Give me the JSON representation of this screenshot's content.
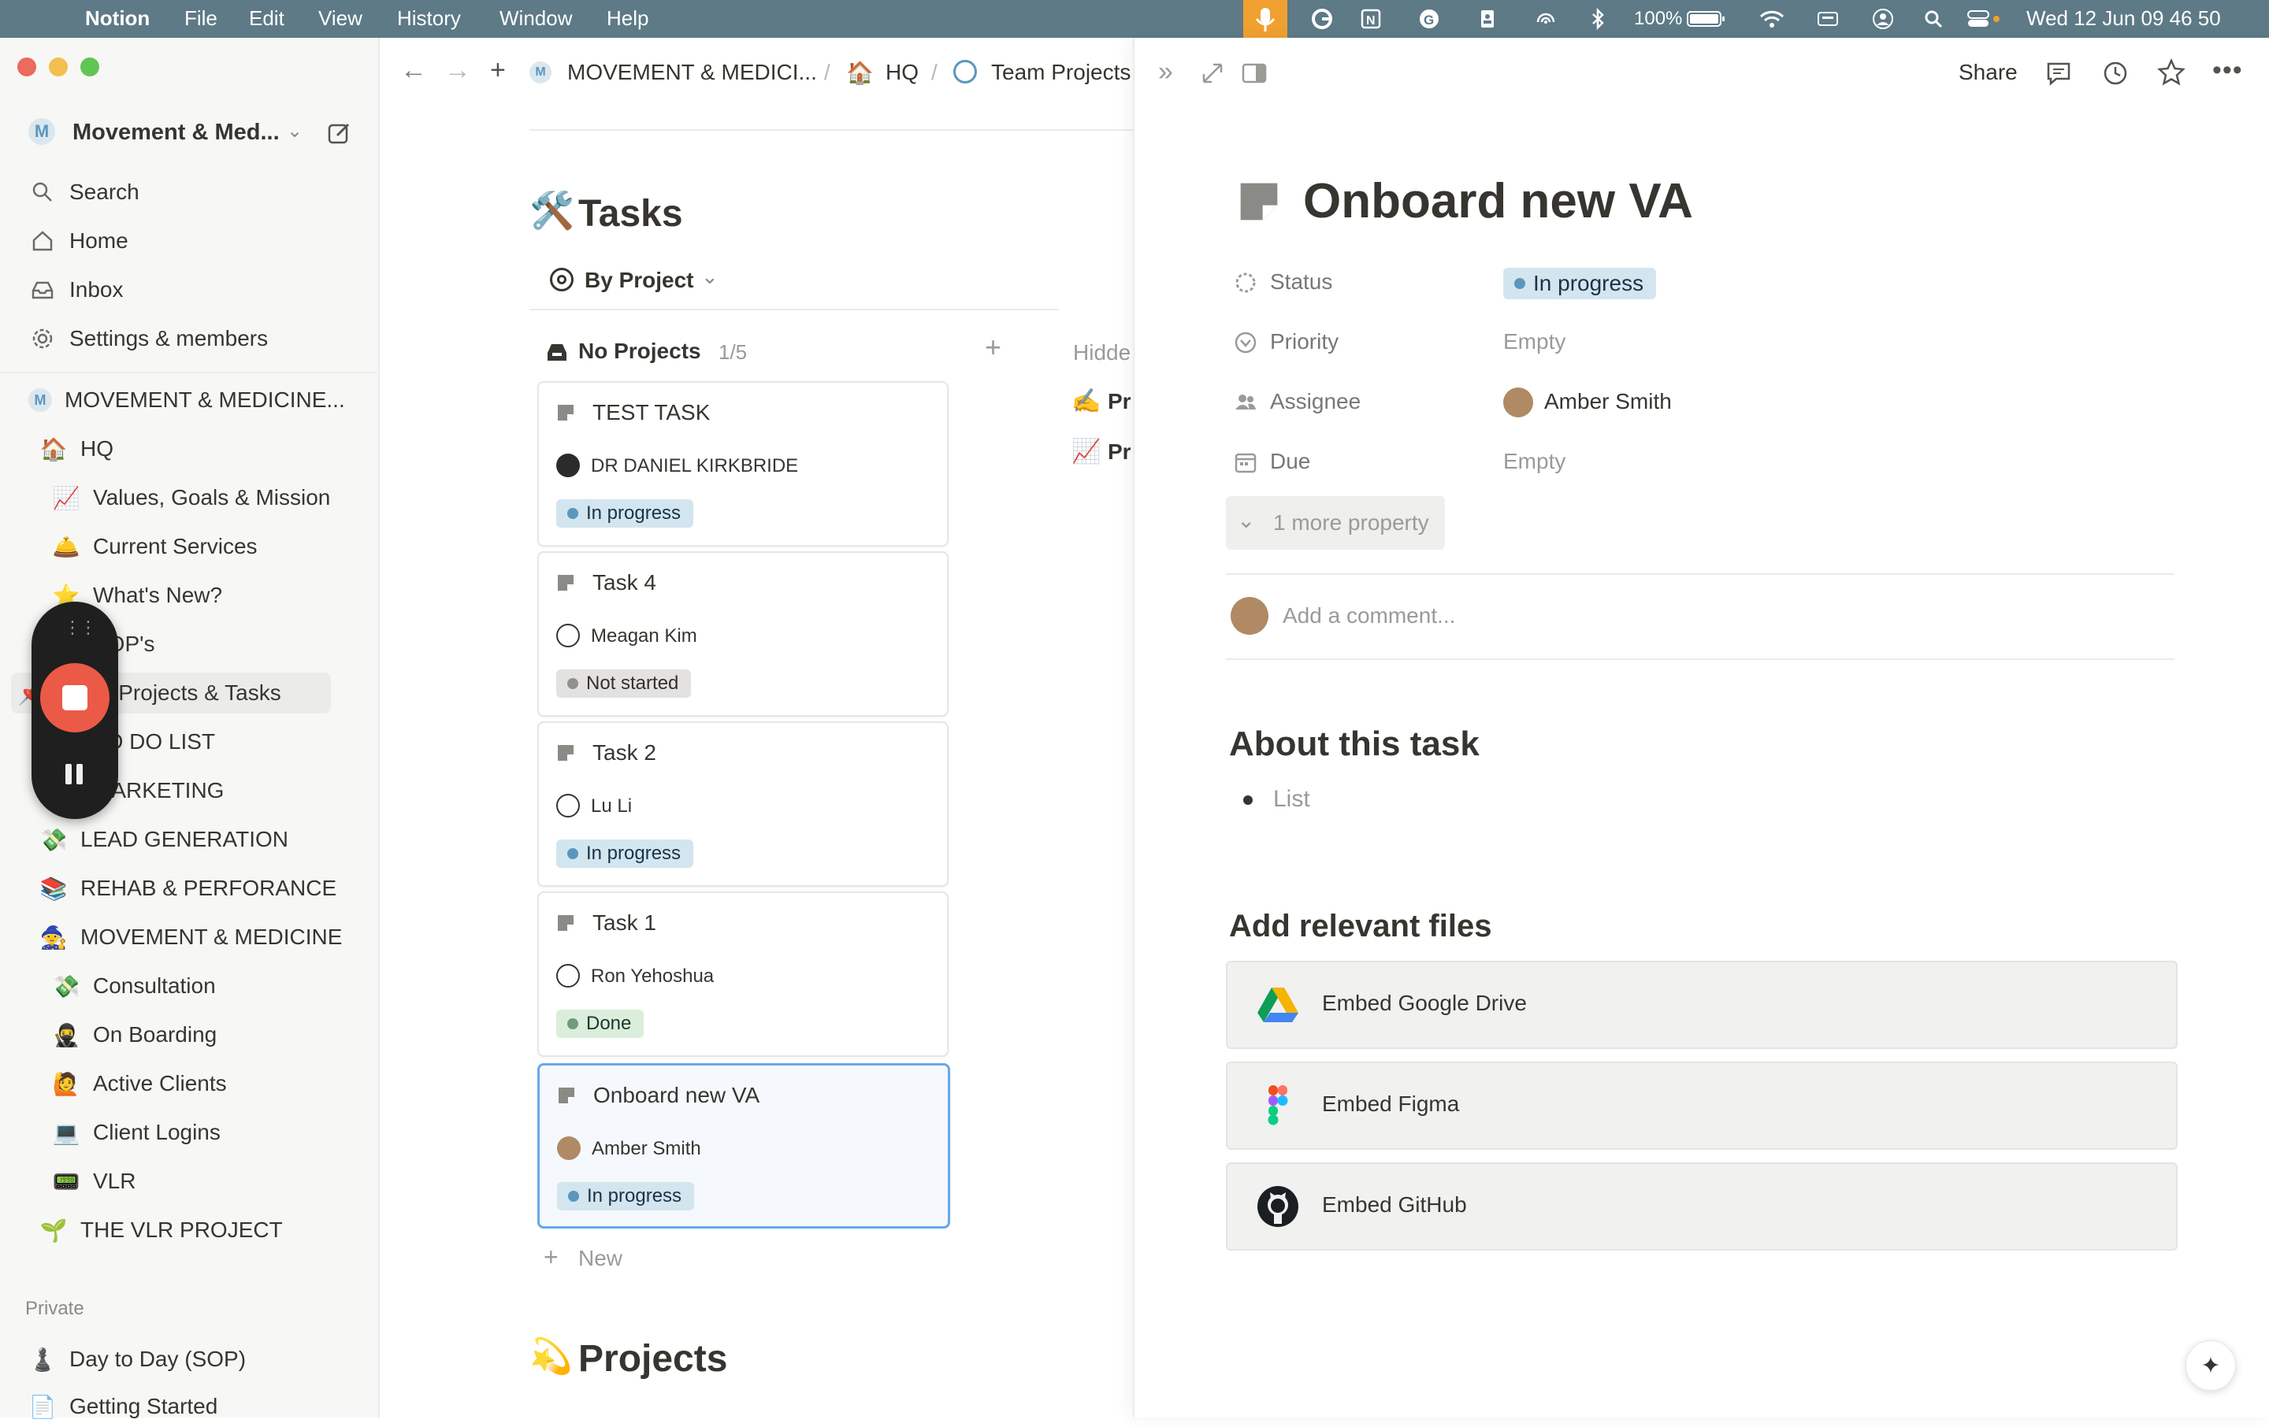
{
  "menubar": {
    "app_name": "Notion",
    "menus": [
      "File",
      "Edit",
      "View",
      "History",
      "Window",
      "Help"
    ],
    "battery": "100%",
    "datetime": "Wed 12 Jun  09 46 50"
  },
  "sidebar": {
    "workspace_name": "Movement & Med...",
    "nav": [
      {
        "label": "Search",
        "icon": "search-icon"
      },
      {
        "label": "Home",
        "icon": "home-icon"
      },
      {
        "label": "Inbox",
        "icon": "inbox-icon"
      },
      {
        "label": "Settings & members",
        "icon": "gear-icon"
      }
    ],
    "teamspace_name": "MOVEMENT & MEDICINE...",
    "tree": [
      {
        "label": "HQ",
        "emoji": "🏠",
        "level": 0
      },
      {
        "label": "Values, Goals & Mission",
        "emoji": "📈",
        "level": 1
      },
      {
        "label": "Current Services",
        "emoji": "🛎️",
        "level": 1
      },
      {
        "label": "What's New?",
        "emoji": "⭐",
        "level": 1
      },
      {
        "label": "SOP's",
        "emoji": "📋",
        "level": 1
      },
      {
        "label": "Team Projects & Tasks",
        "emoji": "📌",
        "level": 1
      },
      {
        "label": "TO DO LIST",
        "emoji": "✅",
        "level": 1
      },
      {
        "label": "MARKETING",
        "emoji": "📣",
        "level": 1
      },
      {
        "label": "LEAD GENERATION",
        "emoji": "💸",
        "level": 0
      },
      {
        "label": "REHAB & PERFORANCE",
        "emoji": "📚",
        "level": 0
      },
      {
        "label": "MOVEMENT & MEDICINE",
        "emoji": "🧙",
        "level": 0
      },
      {
        "label": "Consultation",
        "emoji": "💸",
        "level": 1
      },
      {
        "label": "On Boarding",
        "emoji": "🥷",
        "level": 1
      },
      {
        "label": "Active Clients",
        "emoji": "🙋",
        "level": 1
      },
      {
        "label": "Client Logins",
        "emoji": "💻",
        "level": 1
      },
      {
        "label": "VLR",
        "emoji": "📟",
        "level": 1
      },
      {
        "label": "THE VLR PROJECT",
        "emoji": "🌱",
        "level": 0
      }
    ],
    "private_header": "Private",
    "private_items": [
      {
        "label": "Day to Day (SOP)",
        "emoji": "♟️"
      },
      {
        "label": "Getting Started",
        "emoji": "📄"
      }
    ]
  },
  "topbar": {
    "breadcrumb": [
      "MOVEMENT & MEDICI...",
      "HQ",
      "Team Projects"
    ],
    "share_label": "Share"
  },
  "tasks_db": {
    "title": "Tasks",
    "title_emoji": "🛠️",
    "view_name": "By Project",
    "group_name": "No Projects",
    "group_count": "1/5",
    "hidden_label": "Hidde",
    "hidden_items": [
      {
        "emoji": "✍️",
        "label": "Pr"
      },
      {
        "emoji": "📈",
        "label": "Pr"
      }
    ],
    "cards": [
      {
        "title": "TEST TASK",
        "assignee": "DR DANIEL KIRKBRIDE",
        "status": "In progress",
        "status_kind": "prog"
      },
      {
        "title": "Task 4",
        "assignee": "Meagan Kim",
        "status": "Not started",
        "status_kind": "not"
      },
      {
        "title": "Task 2",
        "assignee": "Lu Li",
        "status": "In progress",
        "status_kind": "prog"
      },
      {
        "title": "Task 1",
        "assignee": "Ron Yehoshua",
        "status": "Done",
        "status_kind": "done"
      },
      {
        "title": "Onboard new VA",
        "assignee": "Amber Smith",
        "status": "In progress",
        "status_kind": "prog"
      }
    ],
    "new_label": "New"
  },
  "projects_db": {
    "title": "Projects",
    "title_emoji": "💫"
  },
  "page": {
    "title": "Onboard new VA",
    "properties": [
      {
        "label": "Status",
        "value": "In progress",
        "icon": "status-icon"
      },
      {
        "label": "Priority",
        "value": "Empty",
        "icon": "priority-icon"
      },
      {
        "label": "Assignee",
        "value": "Amber Smith",
        "icon": "people-icon"
      },
      {
        "label": "Due",
        "value": "Empty",
        "icon": "calendar-icon"
      }
    ],
    "more_props": "1 more property",
    "comment_placeholder": "Add a comment...",
    "about_heading": "About this task",
    "list_placeholder": "List",
    "files_heading": "Add relevant files",
    "embeds": [
      "Embed Google Drive",
      "Embed Figma",
      "Embed GitHub"
    ]
  },
  "colors": {
    "accent_blue": "#6aa8e6",
    "in_progress_bg": "#d3e5ef",
    "not_started_bg": "#e3e2e0",
    "done_bg": "#dbeddb",
    "record_red": "#eb5a46"
  }
}
